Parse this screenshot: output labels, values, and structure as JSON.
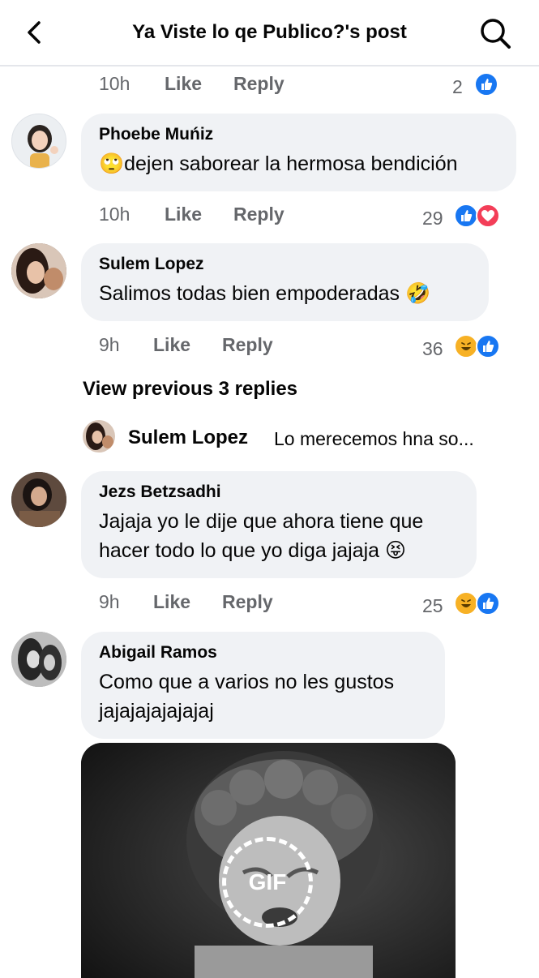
{
  "header": {
    "title": "Ya Viste lo qe Publico?'s post",
    "back_icon": "chevron-left-icon",
    "search_icon": "search-icon"
  },
  "actions": {
    "like": "Like",
    "reply": "Reply"
  },
  "top_meta": {
    "time": "10h",
    "reaction_count": "2",
    "reactions": [
      "like"
    ]
  },
  "comments": [
    {
      "name": "Phoebe Muńiz",
      "text": "🙄dejen saborear la hermosa bendición",
      "time": "10h",
      "reaction_count": "29",
      "reactions": [
        "like",
        "love"
      ]
    },
    {
      "name": "Sulem Lopez",
      "text": "Salimos todas bien empoderadas 🤣",
      "time": "9h",
      "reaction_count": "36",
      "reactions": [
        "haha",
        "like"
      ]
    },
    {
      "name": "Jezs Betzsadhi",
      "text_line1": "Jajaja yo le dije que ahora tiene que",
      "text_line2": "hacer todo lo que yo diga jajaja 😝",
      "time": "9h",
      "reaction_count": "25",
      "reactions": [
        "haha",
        "like"
      ]
    },
    {
      "name": "Abigail Ramos",
      "text_line1": "Como que a varios no les gustos",
      "text_line2": "jajajajajajajaj"
    }
  ],
  "view_previous": "View previous 3 replies",
  "reply_preview": {
    "name": "Sulem Lopez",
    "text": "Lo merecemos hna  so..."
  },
  "gif": {
    "label": "GIF"
  },
  "colors": {
    "accent": "#1877f2",
    "love": "#f33e58",
    "haha": "#f7b125",
    "bubble": "#f0f2f5",
    "meta": "#65676b"
  }
}
